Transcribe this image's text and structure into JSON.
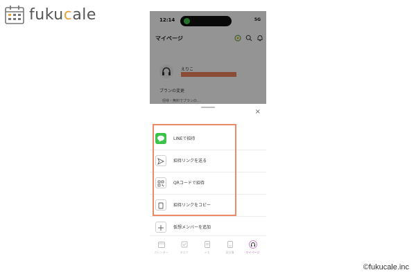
{
  "brand": {
    "name_prefix": "fuku",
    "name_accent": "c",
    "name_suffix": "ale",
    "accent_color": "#e8a23a"
  },
  "copyright": "©fukucale.inc",
  "phone": {
    "status": {
      "time": "12:14",
      "right": "5G"
    },
    "header": {
      "title": "マイページ",
      "icons": [
        "leaf-icon",
        "search-icon",
        "bell-icon"
      ]
    },
    "profile": {
      "name": "えりこ",
      "plan_label": "プランの変更",
      "plan_sub": "招待・無料でプランの…"
    },
    "sheet": {
      "close": "×",
      "items": [
        {
          "label": "LINEで招待",
          "icon": "line-icon"
        },
        {
          "label": "招待リンクを送る",
          "icon": "send-icon"
        },
        {
          "label": "QRコードで招待",
          "icon": "qr-code-icon"
        },
        {
          "label": "招待リンクをコピー",
          "icon": "copy-icon"
        },
        {
          "label": "仮想メンバーを追加",
          "icon": "plus-icon"
        }
      ],
      "highlight_color": "#ec8a65"
    },
    "tabs": [
      {
        "label": "カレンダー",
        "icon": "calendar-icon"
      },
      {
        "label": "タスク",
        "icon": "checkbox-icon"
      },
      {
        "label": "メモ",
        "icon": "memo-icon"
      },
      {
        "label": "家計簿",
        "icon": "notebook-icon"
      },
      {
        "label": "マイページ",
        "icon": "mypage-icon",
        "active": true
      }
    ]
  }
}
